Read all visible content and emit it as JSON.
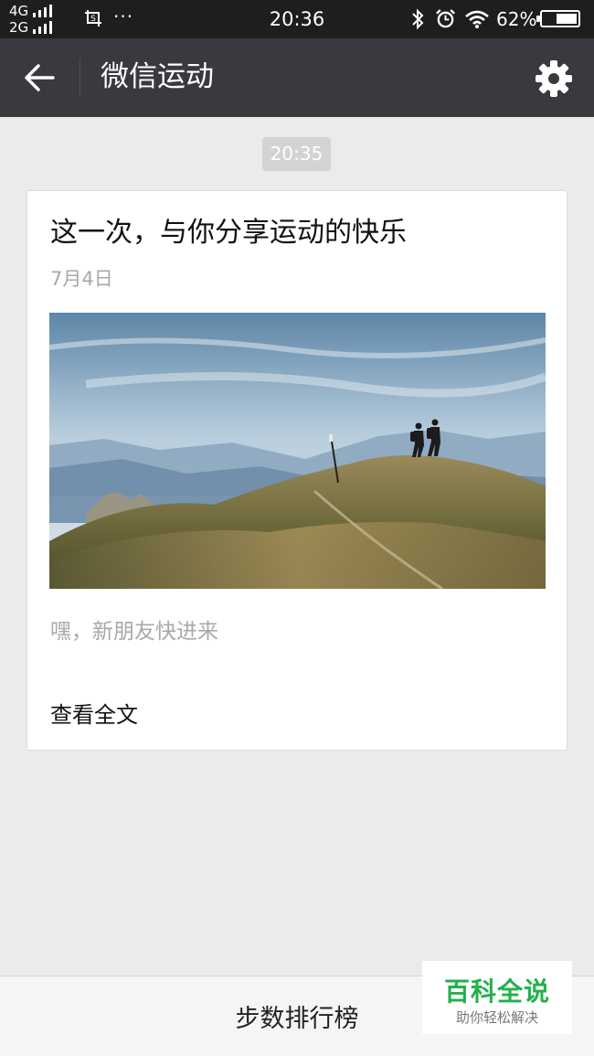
{
  "status_bar": {
    "network_top": "4G",
    "network_bottom": "2G",
    "more": "···",
    "time": "20:36",
    "battery": "62%",
    "battery_level": 0.62
  },
  "titlebar": {
    "back_icon": "back-arrow-icon",
    "title": "微信运动",
    "settings_icon": "gear-icon"
  },
  "chat": {
    "timestamp": "20:35"
  },
  "card": {
    "title": "这一次，与你分享运动的快乐",
    "date": "7月4日",
    "image": "hikers-on-mountain-ridge",
    "description": "嘿，新朋友快进来",
    "link": "查看全文"
  },
  "bottom_bar": {
    "label": "步数排行榜"
  },
  "watermark": {
    "title": "百科全说",
    "subtitle": "助你轻松解决"
  },
  "colors": {
    "titlebar_bg": "#393a3f",
    "page_bg": "#ebebeb",
    "watermark_green": "#22b14c"
  }
}
